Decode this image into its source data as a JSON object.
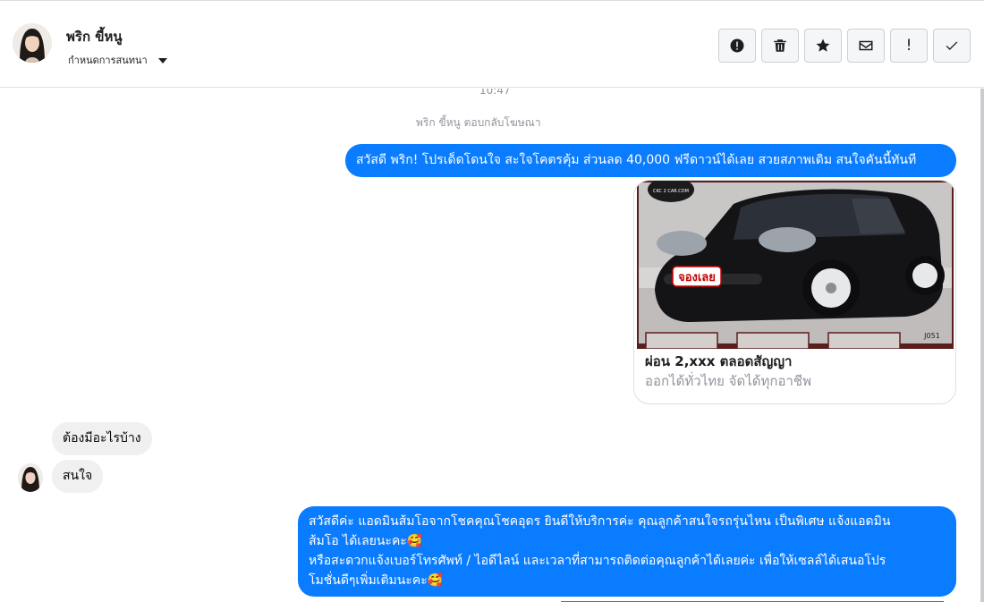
{
  "header": {
    "contact_name": "พริก ขี้หนู",
    "conversation_settings_label": "กำหนดการสนทนา",
    "actions": [
      {
        "name": "alert-icon",
        "tooltip": ""
      },
      {
        "name": "trash-icon",
        "tooltip": ""
      },
      {
        "name": "star-icon",
        "tooltip": ""
      },
      {
        "name": "envelope-icon",
        "tooltip": ""
      },
      {
        "name": "exclamation-icon",
        "label": "!"
      },
      {
        "name": "checkmark-icon",
        "tooltip": ""
      }
    ]
  },
  "thread": {
    "timestamp": "10:47",
    "reply_note": "พริก ขี้หนู ตอบกลับโฆษณา",
    "messages": [
      {
        "from": "page",
        "text": "สวัสดี พริก! โปรเด็ดโดนใจ สะใจโคตรคุ้ม ส่วนลด 40,000 ฟรีดาวน์ได้เลย สวยสภาพเดิม สนใจคันนี้ทันที"
      },
      {
        "from": "page",
        "type": "card",
        "image_badge": "จองเลย",
        "image_tag": "J051",
        "image_logo": "CKC 2 CAR.COM",
        "title": "ผ่อน 2,xxx ตลอดสัญญา",
        "subtitle": "ออกได้ทั่วไทย จัดได้ทุกอาชีพ"
      },
      {
        "from": "user",
        "text": "ต้องมีอะไรบ้าง"
      },
      {
        "from": "user",
        "text": "สนใจ"
      },
      {
        "from": "page",
        "line1": "สวัสดีค่ะ แอดมินส้มโอจากโชคคุณโชคอุดร ยินดีให้บริการค่ะ   คุณลูกค้าสนใจรถรุ่นไหน เป็นพิเศษ แจ้งแอดมิน",
        "line2": "ส้มโอ ได้เลยนะคะ🥰",
        "line3": "หรือสะดวกแจ้งเบอร์โทรศัพท์ / ไอดีไลน์ และเวลาที่สามารถติดต่อคุณลูกค้าได้เลยค่ะ เพื่อให้เซลล์ได้เสนอโปร",
        "line4": "โมชั่นดีๆเพิ่มเติมนะคะ🥰"
      }
    ]
  },
  "colors": {
    "outgoing_bubble": "#0a7cff",
    "incoming_bubble": "#f0f0f0",
    "meta_text": "#90949c"
  }
}
